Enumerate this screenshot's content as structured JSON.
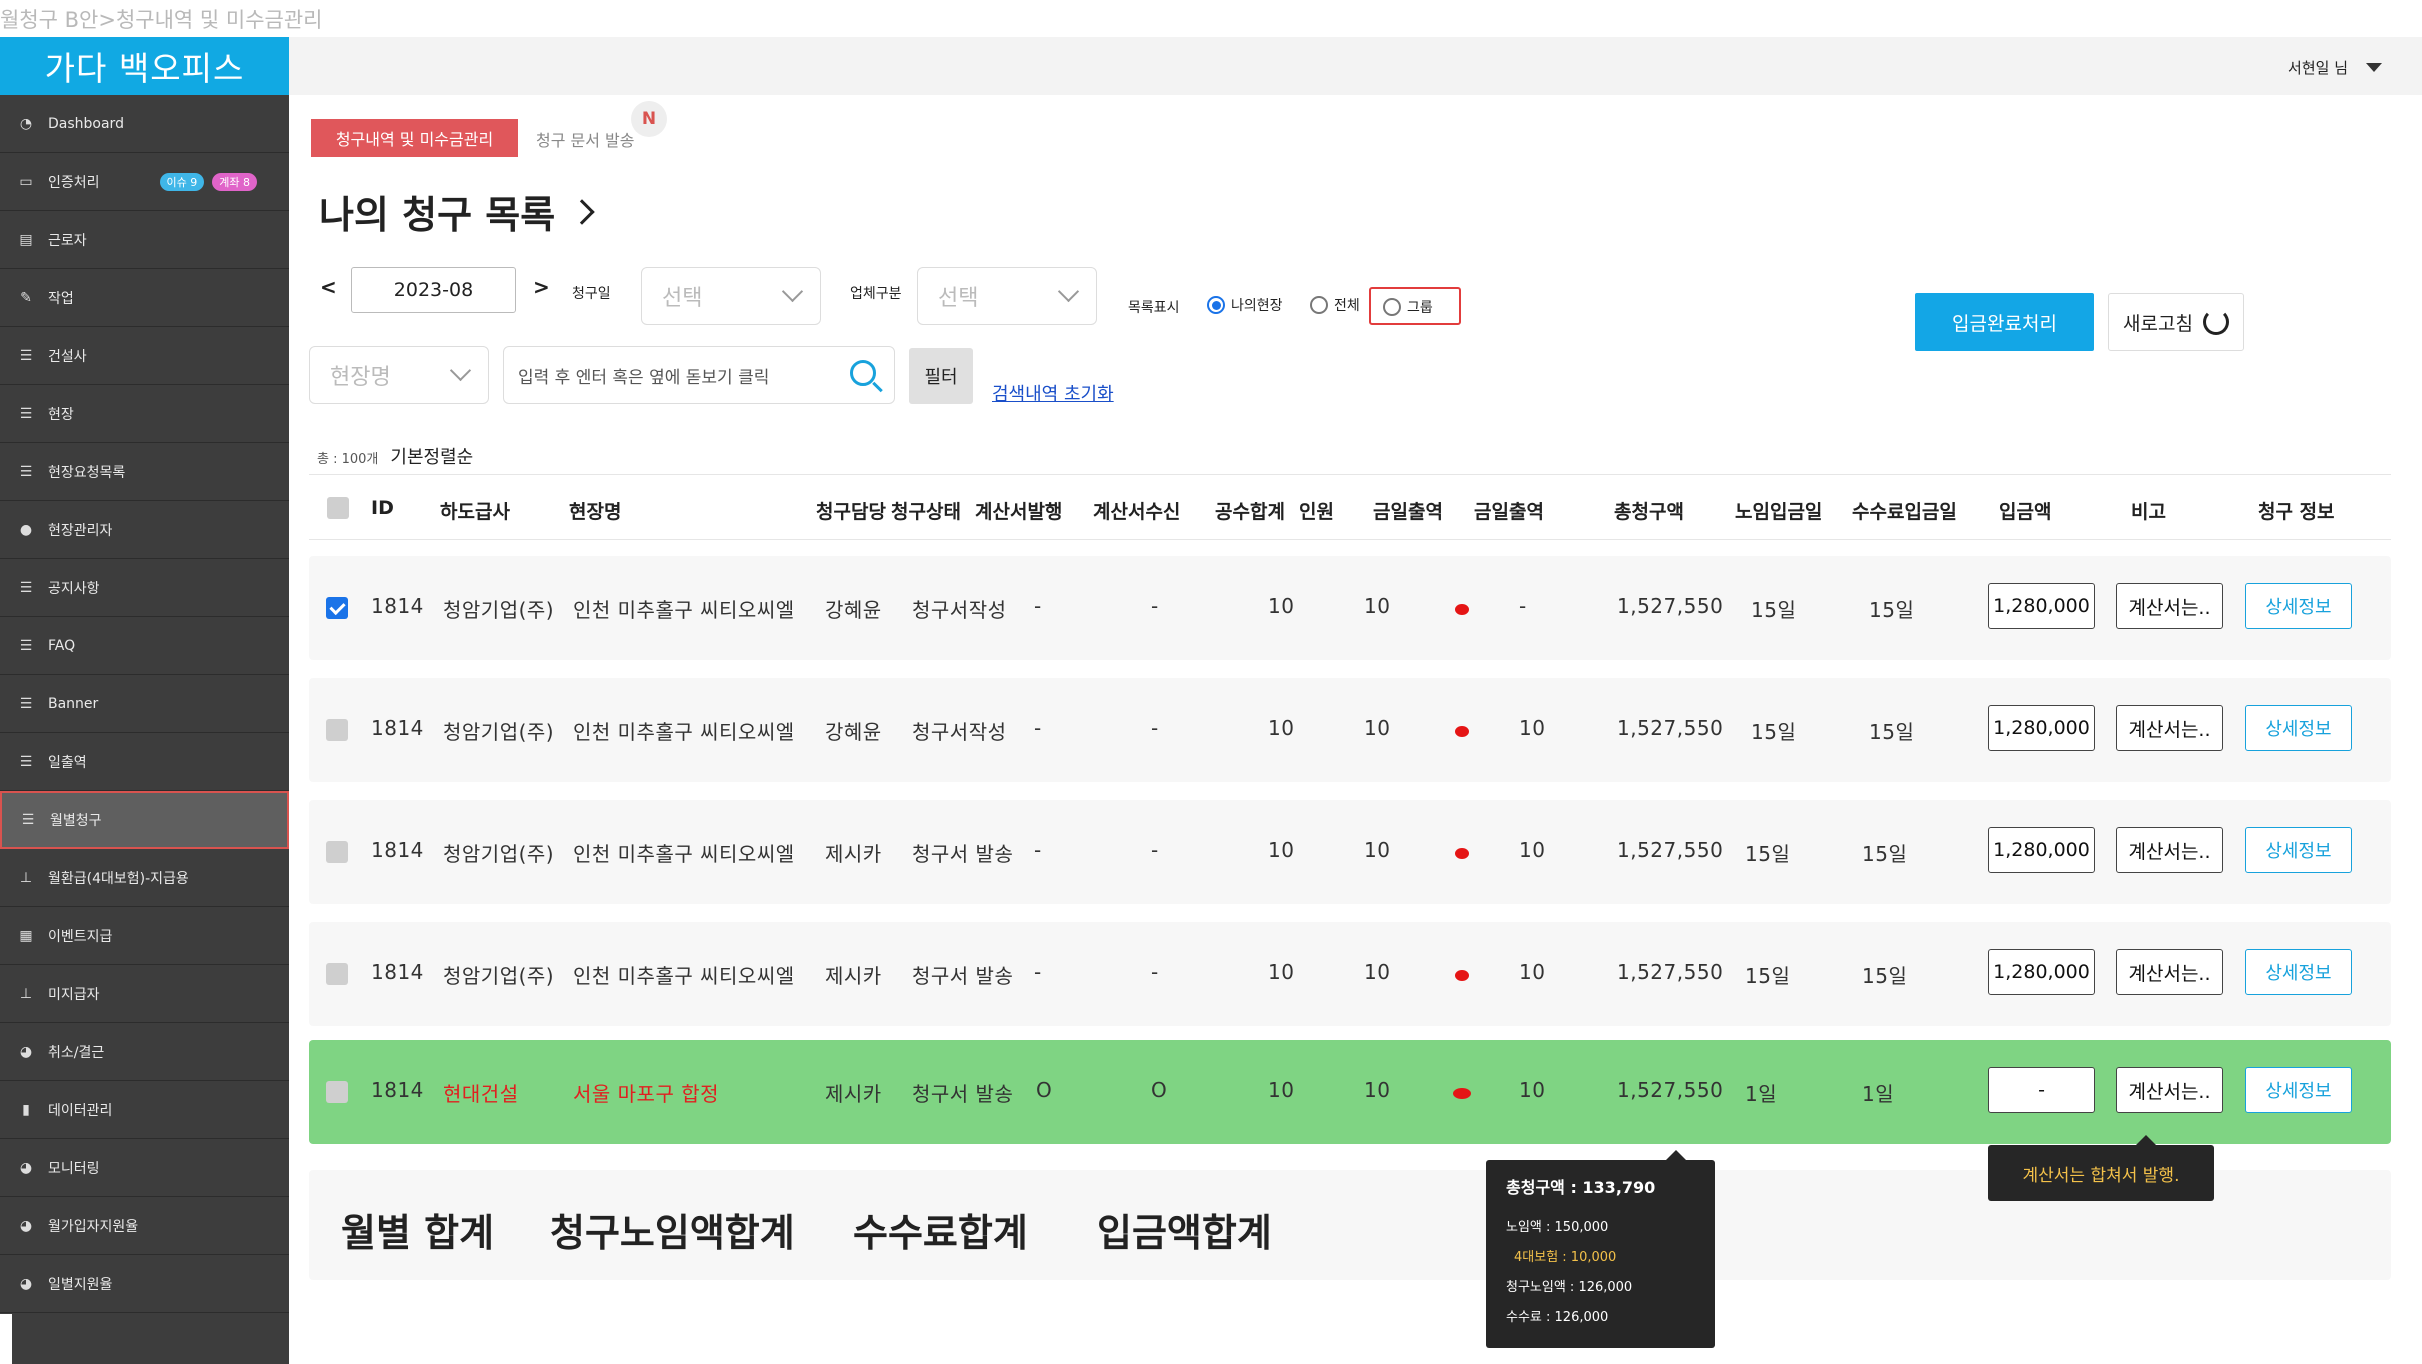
{
  "page_caption": "월청구 B안>청구내역 및 미수금관리",
  "brand": "가다 백오피스",
  "sidebar": {
    "items": [
      {
        "label": "Dashboard",
        "icon": "dashboard-icon"
      },
      {
        "label": "인증처리",
        "icon": "monitor-icon",
        "badges": [
          "이슈 9",
          "계좌 8"
        ]
      },
      {
        "label": "근로자",
        "icon": "id-card-icon"
      },
      {
        "label": "작업",
        "icon": "edit-icon"
      },
      {
        "label": "건설사",
        "icon": "list-icon"
      },
      {
        "label": "현장",
        "icon": "list-icon"
      },
      {
        "label": "현장요청목록",
        "icon": "list-icon"
      },
      {
        "label": "현장관리자",
        "icon": "user-icon"
      },
      {
        "label": "공지사항",
        "icon": "list-icon"
      },
      {
        "label": "FAQ",
        "icon": "list-icon"
      },
      {
        "label": "Banner",
        "icon": "list-icon"
      },
      {
        "label": "일출역",
        "icon": "list-icon"
      },
      {
        "label": "월별청구",
        "icon": "list-icon",
        "active": true
      },
      {
        "label": "월환급(4대보험)-지급용",
        "icon": "sitemap-icon"
      },
      {
        "label": "이벤트지급",
        "icon": "gift-icon"
      },
      {
        "label": "미지급자",
        "icon": "sitemap-icon"
      },
      {
        "label": "취소/결근",
        "icon": "pie-icon"
      },
      {
        "label": "데이터관리",
        "icon": "file-icon"
      },
      {
        "label": "모니터링",
        "icon": "pie-icon"
      },
      {
        "label": "월가입자지원율",
        "icon": "pie-icon"
      },
      {
        "label": "일별지원율",
        "icon": "pie-icon"
      }
    ]
  },
  "topbar": {
    "user": "서현일 님"
  },
  "tabs": {
    "active": "청구내역 및 미수금관리",
    "inactive": "청구 문서 발송",
    "badge": "N"
  },
  "title": "나의 청구 목록",
  "filters": {
    "prev": "<",
    "next": ">",
    "month": "2023-08",
    "billing_day_label": "청구일",
    "billing_day_value": "선택",
    "biz_type_label": "업체구분",
    "biz_type_value": "선택",
    "list_label": "목록표시",
    "radio_mine": "나의현장",
    "radio_all": "전체",
    "radio_group": "그룹",
    "site_value": "현장명",
    "search_placeholder": "입력 후 엔터 혹은 옆에 돋보기 클릭",
    "filter_button": "필터",
    "reset_link": "검색내역 초기화"
  },
  "actions": {
    "complete": "입금완료처리",
    "refresh": "새로고침"
  },
  "total": {
    "count": "총 : 100개",
    "sort": "기본정렬순"
  },
  "table": {
    "headers": [
      "ID",
      "하도급사",
      "현장명",
      "청구담당",
      "청구상태",
      "계산서발행",
      "계산서수신",
      "공수합계",
      "인원",
      "금일출역",
      "금일출역",
      "총청구액",
      "노임입금일",
      "수수료입금일",
      "입금액",
      "비고",
      "청구 정보"
    ],
    "rows": [
      {
        "id": "1814",
        "sub": "청암기업(주)",
        "site": "인천 미추홀구 씨티오씨엘",
        "manager": "강혜윤",
        "status": "청구서작성",
        "issue": "-",
        "recv": "-",
        "sum": "10",
        "people": "10",
        "today2": "-",
        "total": "1,527,550",
        "wage_day": "15일",
        "fee_day": "15일",
        "deposit": "1,280,000",
        "note": "계산서는..",
        "detail": "상세정보",
        "checked": true
      },
      {
        "id": "1814",
        "sub": "청암기업(주)",
        "site": "인천 미추홀구 씨티오씨엘",
        "manager": "강혜윤",
        "status": "청구서작성",
        "issue": "-",
        "recv": "-",
        "sum": "10",
        "people": "10",
        "today2": "10",
        "total": "1,527,550",
        "wage_day": "15일",
        "fee_day": "15일",
        "deposit": "1,280,000",
        "note": "계산서는..",
        "detail": "상세정보",
        "checked": false
      },
      {
        "id": "1814",
        "sub": "청암기업(주)",
        "site": "인천 미추홀구 씨티오씨엘",
        "manager": "제시카",
        "status": "청구서 발송",
        "issue": "-",
        "recv": "-",
        "sum": "10",
        "people": "10",
        "today2": "10",
        "total": "1,527,550",
        "wage_day": "15일",
        "fee_day": "15일",
        "deposit": "1,280,000",
        "note": "계산서는..",
        "detail": "상세정보",
        "checked": false
      },
      {
        "id": "1814",
        "sub": "청암기업(주)",
        "site": "인천 미추홀구 씨티오씨엘",
        "manager": "제시카",
        "status": "청구서 발송",
        "issue": "-",
        "recv": "-",
        "sum": "10",
        "people": "10",
        "today2": "10",
        "total": "1,527,550",
        "wage_day": "15일",
        "fee_day": "15일",
        "deposit": "1,280,000",
        "note": "계산서는..",
        "detail": "상세정보",
        "checked": false
      },
      {
        "id": "1814",
        "sub": "현대건설",
        "site": "서울 마포구 합정",
        "manager": "제시카",
        "status": "청구서 발송",
        "issue": "O",
        "recv": "O",
        "sum": "10",
        "people": "10",
        "today2": "10",
        "total": "1,527,550",
        "wage_day": "1일",
        "fee_day": "1일",
        "deposit": "-",
        "note": "계산서는..",
        "detail": "상세정보",
        "checked": false
      }
    ]
  },
  "summary": {
    "monthly": "월별 합계",
    "wage": "청구노임액합계",
    "fee": "수수료합계",
    "deposit": "입금액합계"
  },
  "tooltip_total": {
    "title": "총청구액 : 133,790",
    "wage": "노임액 : 150,000",
    "insurance": "4대보험 : 10,000",
    "billed_wage": "청구노임액 : 126,000",
    "fee": "수수료 : 126,000"
  },
  "tooltip_note": "계산서는 합쳐서 발행.",
  "colors": {
    "brand": "#11a9e3",
    "accent_red": "#e0575b",
    "highlight_row": "#7fd483",
    "link": "#1a4fc9"
  }
}
